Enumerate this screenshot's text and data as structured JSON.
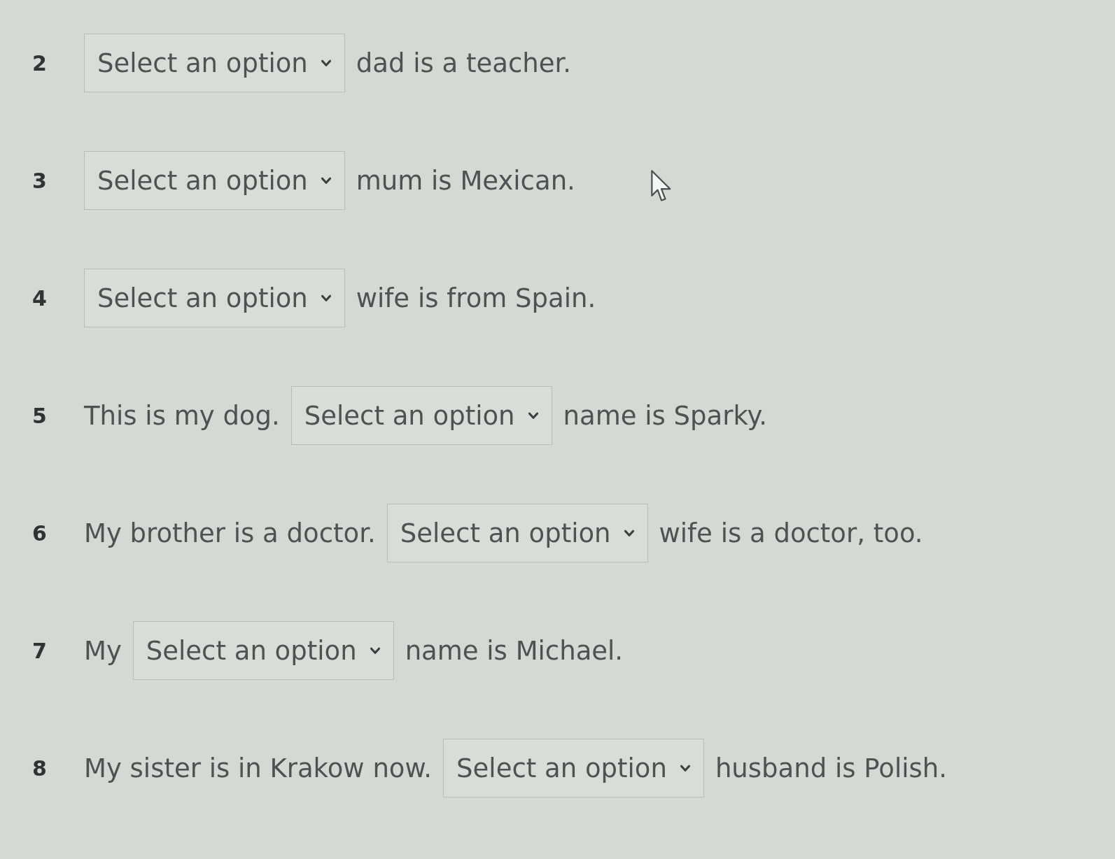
{
  "questions": [
    {
      "number": "2",
      "dropdown": {
        "placeholder": "Select an option"
      },
      "text_after": "dad is a teacher."
    },
    {
      "number": "3",
      "dropdown": {
        "placeholder": "Select an option"
      },
      "text_after": "mum is Mexican."
    },
    {
      "number": "4",
      "dropdown": {
        "placeholder": "Select an option"
      },
      "text_after": "wife is from Spain."
    },
    {
      "number": "5",
      "text_before": "This is my dog.",
      "dropdown": {
        "placeholder": "Select an option"
      },
      "text_after": "name is Sparky."
    },
    {
      "number": "6",
      "text_before": "My brother is a doctor.",
      "dropdown": {
        "placeholder": "Select an option"
      },
      "text_after": "wife is a doctor, too."
    },
    {
      "number": "7",
      "text_before": "My",
      "dropdown": {
        "placeholder": "Select an option"
      },
      "text_after": "name is Michael."
    },
    {
      "number": "8",
      "text_before": "My sister is in Krakow now.",
      "dropdown": {
        "placeholder": "Select an option"
      },
      "text_after": "husband is Polish."
    }
  ]
}
